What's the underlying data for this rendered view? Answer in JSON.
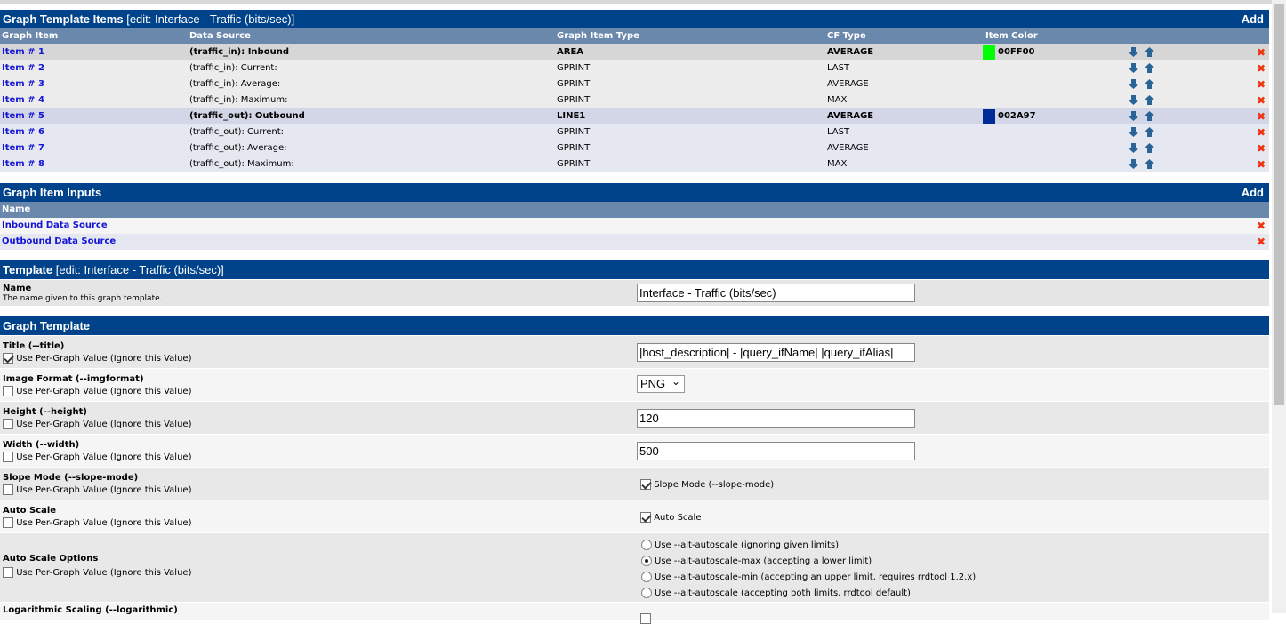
{
  "items_section": {
    "title": "Graph Template Items",
    "edit": "[edit: Interface - Traffic (bits/sec)]",
    "add": "Add",
    "columns": [
      "Graph Item",
      "Data Source",
      "Graph Item Type",
      "CF Type",
      "Item Color"
    ],
    "rows": [
      {
        "item": "Item # 1",
        "source": "(traffic_in): Inbound",
        "type": "AREA",
        "cf": "AVERAGE",
        "color": "00FF00",
        "swatch": "#00FF00",
        "bold": true,
        "bg": "#d6d6d6"
      },
      {
        "item": "Item # 2",
        "source": "(traffic_in): Current:",
        "type": "GPRINT",
        "cf": "LAST",
        "color": "",
        "bold": false,
        "bg": "#ececec"
      },
      {
        "item": "Item # 3",
        "source": "(traffic_in): Average:",
        "type": "GPRINT",
        "cf": "AVERAGE",
        "color": "",
        "bold": false,
        "bg": "#ececec"
      },
      {
        "item": "Item # 4",
        "source": "(traffic_in): Maximum:",
        "type": "GPRINT",
        "cf": "MAX",
        "color": "",
        "bold": false,
        "bg": "#ececec"
      },
      {
        "item": "Item # 5",
        "source": "(traffic_out): Outbound",
        "type": "LINE1",
        "cf": "AVERAGE",
        "color": "002A97",
        "swatch": "#002A97",
        "bold": true,
        "bg": "#d3d6e6"
      },
      {
        "item": "Item # 6",
        "source": "(traffic_out): Current:",
        "type": "GPRINT",
        "cf": "LAST",
        "color": "",
        "bold": false,
        "bg": "#e6e8f1"
      },
      {
        "item": "Item # 7",
        "source": "(traffic_out): Average:",
        "type": "GPRINT",
        "cf": "AVERAGE",
        "color": "",
        "bold": false,
        "bg": "#e6e8f1"
      },
      {
        "item": "Item # 8",
        "source": "(traffic_out): Maximum:",
        "type": "GPRINT",
        "cf": "MAX",
        "color": "",
        "bold": false,
        "bg": "#e6e8f1"
      }
    ]
  },
  "inputs_section": {
    "title": "Graph Item Inputs",
    "add": "Add",
    "column": "Name",
    "rows": [
      "Inbound Data Source",
      "Outbound Data Source"
    ]
  },
  "template_section": {
    "title": "Template",
    "edit": "[edit: Interface - Traffic (bits/sec)]",
    "name_label": "Name",
    "name_desc": "The name given to this graph template.",
    "name_value": "Interface - Traffic (bits/sec)"
  },
  "graph_template": {
    "title": "Graph Template",
    "per_graph": "Use Per-Graph Value (Ignore this Value)",
    "fields": [
      {
        "label": "Title (--title)",
        "per_graph_checked": true,
        "kind": "text",
        "value": "|host_description| - |query_ifName| |query_ifAlias|"
      },
      {
        "label": "Image Format (--imgformat)",
        "per_graph_checked": false,
        "kind": "select",
        "value": "PNG"
      },
      {
        "label": "Height (--height)",
        "per_graph_checked": false,
        "kind": "text",
        "value": "120"
      },
      {
        "label": "Width (--width)",
        "per_graph_checked": false,
        "kind": "text",
        "value": "500"
      },
      {
        "label": "Slope Mode (--slope-mode)",
        "per_graph_checked": false,
        "kind": "check",
        "value": "Slope Mode (--slope-mode)",
        "checked": true
      },
      {
        "label": "Auto Scale",
        "per_graph_checked": false,
        "kind": "check",
        "value": "Auto Scale",
        "checked": true
      }
    ],
    "autoscale_options": {
      "label": "Auto Scale Options",
      "selected": 1,
      "options": [
        "Use --alt-autoscale (ignoring given limits)",
        "Use --alt-autoscale-max (accepting a lower limit)",
        "Use --alt-autoscale-min (accepting an upper limit, requires rrdtool 1.2.x)",
        "Use --alt-autoscale (accepting both limits, rrdtool default)"
      ]
    },
    "log_label": "Logarithmic Scaling (--logarithmic)"
  }
}
